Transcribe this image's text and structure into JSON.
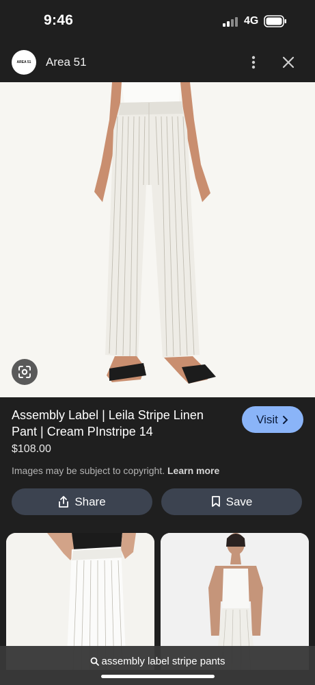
{
  "status_bar": {
    "time": "9:46",
    "network": "4G"
  },
  "header": {
    "site_name": "Area 51",
    "logo_text": "AREA 51"
  },
  "product": {
    "title": "Assembly Label | Leila Stripe Linen Pant | Cream PInstripe 14",
    "price": "$108.00",
    "copyright_text": "Images may be subject to copyright.",
    "learn_more": "Learn more",
    "visit_label": "Visit"
  },
  "actions": {
    "share_label": "Share",
    "save_label": "Save"
  },
  "search": {
    "query": "assembly label stripe pants"
  },
  "icons": {
    "signal": "signal-bars-icon",
    "battery": "battery-icon",
    "more": "more-vertical-icon",
    "close": "close-icon",
    "lens": "google-lens-icon",
    "share": "share-icon",
    "save": "bookmark-icon",
    "search": "search-icon",
    "visit": "chevron-right-icon"
  },
  "colors": {
    "background": "#1f1f1f",
    "visit_button": "#8ab4f8",
    "action_button": "#3c4350"
  }
}
